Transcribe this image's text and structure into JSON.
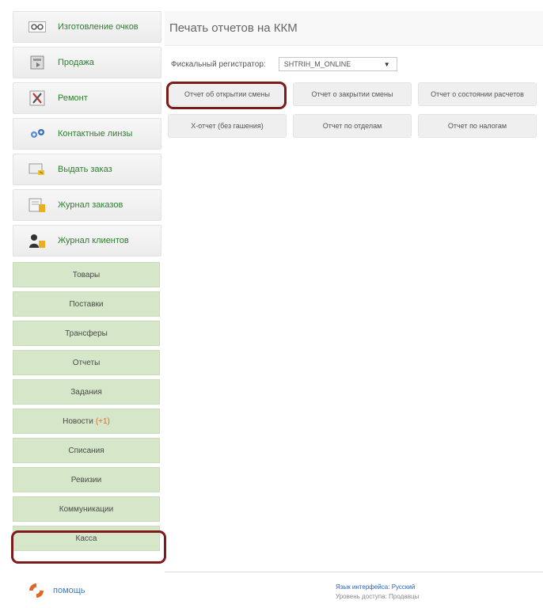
{
  "sidebar": {
    "nav": [
      {
        "label": "Изготовление очков",
        "icon": "glasses-icon"
      },
      {
        "label": "Продажа",
        "icon": "sale-icon"
      },
      {
        "label": "Ремонт",
        "icon": "tools-icon"
      },
      {
        "label": "Контактные линзы",
        "icon": "contact-lenses-icon"
      },
      {
        "label": "Выдать заказ",
        "icon": "give-order-icon"
      },
      {
        "label": "Журнал заказов",
        "icon": "orders-journal-icon"
      },
      {
        "label": "Журнал клиентов",
        "icon": "clients-journal-icon"
      }
    ],
    "sections": [
      {
        "label": "Товары"
      },
      {
        "label": "Поставки"
      },
      {
        "label": "Трансферы"
      },
      {
        "label": "Отчеты"
      },
      {
        "label": "Задания"
      },
      {
        "label": "Новости",
        "badge": "(+1)"
      },
      {
        "label": "Списания"
      },
      {
        "label": "Ревизии"
      },
      {
        "label": "Коммуникации"
      },
      {
        "label": "Касса"
      }
    ]
  },
  "main": {
    "title": "Печать отчетов на ККМ",
    "registrar_label": "Фискальный регистратор:",
    "registrar_value": "SHTRIH_M_ONLINE",
    "buttons": [
      {
        "label": "Отчет об открытии смены"
      },
      {
        "label": "Отчет о закрытии смены"
      },
      {
        "label": "Отчет о состоянии расчетов"
      },
      {
        "label": "X-отчет (без гашения)"
      },
      {
        "label": "Отчет по отделам"
      },
      {
        "label": "Отчет по налогам"
      }
    ]
  },
  "footer": {
    "help": "помощь",
    "lang_label": "Язык интерфейса:",
    "lang_value": "Русский",
    "access_label": "Уровень доступа:",
    "access_value": "Продавцы"
  },
  "colors": {
    "highlight": "#7d1a1a",
    "section_green": "#d6e6c8",
    "nav_text": "#2e7d2e",
    "link": "#2d5fb0",
    "badge": "#e06a2a"
  }
}
